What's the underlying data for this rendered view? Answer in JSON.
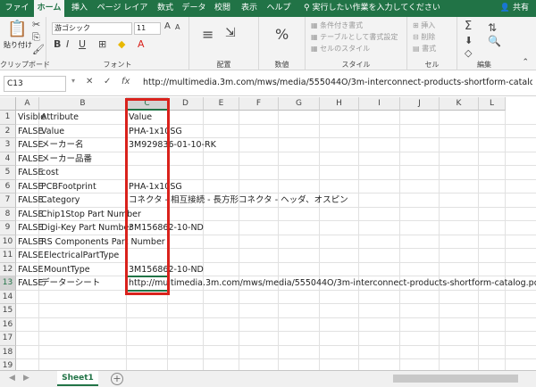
{
  "ribbon_tabs": [
    "ファイル",
    "ホーム",
    "挿入",
    "ページ レイアウト",
    "数式",
    "データ",
    "校閲",
    "表示",
    "ヘルプ"
  ],
  "tell_me": "実行したい作業を入力してください",
  "share": "共有",
  "clipboard": {
    "paste": "貼り付け",
    "group": "クリップボード"
  },
  "font": {
    "name": "游ゴシック",
    "size": "11",
    "bold": "B",
    "italic": "I",
    "underline": "U",
    "group": "フォント"
  },
  "alignment": {
    "group": "配置"
  },
  "number": {
    "format_icon": "%",
    "group": "数値"
  },
  "styles": {
    "conditional": "条件付き書式",
    "table": "テーブルとして書式設定",
    "cell_styles": "セルのスタイル",
    "group": "スタイル"
  },
  "cells": {
    "insert": "挿入",
    "delete": "削除",
    "format": "書式",
    "group": "セル"
  },
  "editing": {
    "group": "編集"
  },
  "formula_bar": {
    "name_box": "C13",
    "formula": "http://multimedia.3m.com/mws/media/555044O/3m-interconnect-products-shortform-catalog.pdf"
  },
  "columns": [
    "A",
    "B",
    "C",
    "D",
    "E",
    "F",
    "G",
    "H",
    "I",
    "J",
    "K",
    "L"
  ],
  "rows": [
    {
      "n": "1",
      "a": "Visible",
      "b": "Attribute",
      "c": "Value"
    },
    {
      "n": "2",
      "a": "FALSE",
      "b": "Value",
      "c": "PHA-1x10SG"
    },
    {
      "n": "3",
      "a": "FALSE",
      "b": "メーカー名",
      "c": "3M929836-01-10-RK"
    },
    {
      "n": "4",
      "a": "FALSE",
      "b": "メーカー品番",
      "c": ""
    },
    {
      "n": "5",
      "a": "FALSE",
      "b": "cost",
      "c": ""
    },
    {
      "n": "6",
      "a": "FALSE",
      "b": "PCBFootprint",
      "c": "PHA-1x10SG"
    },
    {
      "n": "7",
      "a": "FALSE",
      "b": "Category",
      "c": "コネクタ - 相互接続 - 長方形コネクタ - ヘッダ、オスピン"
    },
    {
      "n": "8",
      "a": "FALSE",
      "b": "Chip1Stop Part Number",
      "c": ""
    },
    {
      "n": "9",
      "a": "FALSE",
      "b": "Digi-Key Part Number",
      "c": "3M156862-10-ND"
    },
    {
      "n": "10",
      "a": "FALSE",
      "b": "RS Components Part Number",
      "c": ""
    },
    {
      "n": "11",
      "a": "FALSE",
      "b": ".ElectricalPartType",
      "c": ""
    },
    {
      "n": "12",
      "a": "FALSE",
      "b": ".MountType",
      "c": "3M156862-10-ND"
    },
    {
      "n": "13",
      "a": "FALSE",
      "b": "データーシート",
      "c": "http://multimedia.3m.com/mws/media/555044O/3m-interconnect-products-shortform-catalog.pdf"
    },
    {
      "n": "14",
      "a": "",
      "b": "",
      "c": ""
    },
    {
      "n": "15",
      "a": "",
      "b": "",
      "c": ""
    },
    {
      "n": "16",
      "a": "",
      "b": "",
      "c": ""
    },
    {
      "n": "17",
      "a": "",
      "b": "",
      "c": ""
    },
    {
      "n": "18",
      "a": "",
      "b": "",
      "c": ""
    },
    {
      "n": "19",
      "a": "",
      "b": "",
      "c": ""
    }
  ],
  "sheet_tab": "Sheet1",
  "add_sheet": "+",
  "colors": {
    "excel_green": "#217346",
    "highlight_red": "#d9221c"
  }
}
